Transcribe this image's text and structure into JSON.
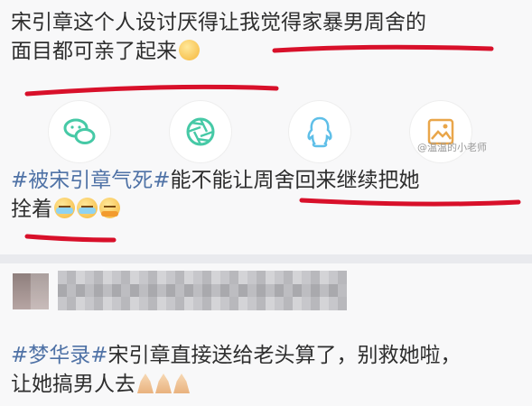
{
  "post1": {
    "line1": "宋引章这个人设讨厌得让我觉得家暴男周舍的",
    "line2": "面目都可亲了起来",
    "emoji": "smirk-face"
  },
  "share": {
    "items": [
      {
        "name": "wechat",
        "icon": "wechat-icon"
      },
      {
        "name": "moments",
        "icon": "camera-aperture-icon"
      },
      {
        "name": "qq",
        "icon": "qq-penguin-icon"
      },
      {
        "name": "image",
        "icon": "picture-icon"
      }
    ],
    "watermark": "@温温的小老师"
  },
  "post2": {
    "hashtag": "#被宋引章气死#",
    "line1_rest": "能不能让周舍回来继续把她",
    "line2": "拴着",
    "emojis": [
      "crying-face",
      "crying-face",
      "hugging-face"
    ]
  },
  "post3": {
    "hashtag": "#梦华录#",
    "line1_rest": "宋引章直接送给老头算了，别救她啦，",
    "line2": "让她搞男人去",
    "emojis": [
      "praying-hands",
      "praying-hands",
      "praying-hands"
    ]
  },
  "colors": {
    "underline": "#d8102a",
    "hashtag": "#4f72a6",
    "share_icon": "#46c9a6",
    "qq_icon": "#5fbfe8"
  }
}
